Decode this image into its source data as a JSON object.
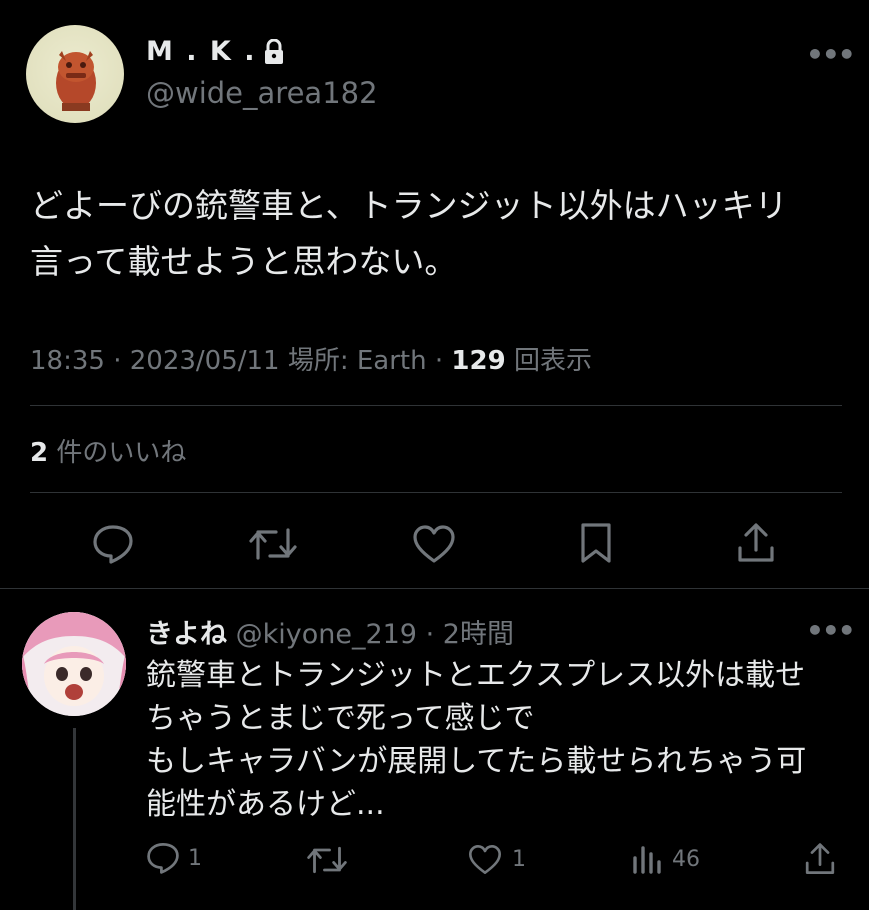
{
  "tweet": {
    "author_name": "M . K .",
    "author_handle": "@wide_area182",
    "more_label": "•••",
    "text_line1": "どよーびの銃警車と、トランジット以外はハッキリ",
    "text_line2": "言って載せようと思わない。",
    "time": "18:35",
    "date": "2023/05/11",
    "location_label": "場所: Earth",
    "views_count": "129",
    "views_label": "回表示",
    "likes_count": "2",
    "likes_label": "件のいいね"
  },
  "action_icons": [
    "reply-icon",
    "retweet-icon",
    "like-icon",
    "bookmark-icon",
    "share-icon"
  ],
  "reply": {
    "author_name": "きよね",
    "author_handle": "@kiyone_219",
    "time_ago": "2時間",
    "more_label": "•••",
    "line1": "銃警車とトランジットとエクスプレス以外は載せ",
    "line2": "ちゃうとまじで死って感じで",
    "line3": "もしキャラバンが展開してたら載せられちゃう可",
    "line4": "能性があるけど...",
    "reply_count": "1",
    "like_count": "1",
    "views_count": "46"
  },
  "colors": {
    "background": "#000000",
    "text": "#e7e9ea",
    "secondary": "#71767b",
    "divider": "#2f3336"
  }
}
